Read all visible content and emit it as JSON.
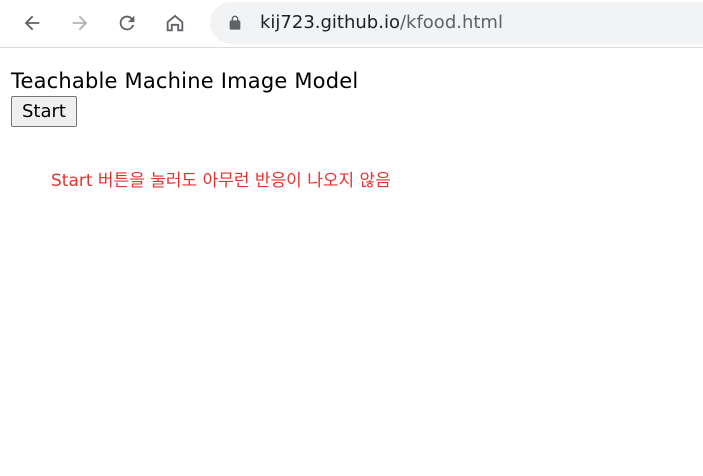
{
  "browser": {
    "url_host": "kij723.github.io",
    "url_path": "/kfood.html",
    "icons": {
      "back": "back-arrow-icon",
      "forward": "forward-arrow-icon",
      "reload": "reload-icon",
      "home": "home-icon",
      "lock": "lock-icon"
    }
  },
  "page": {
    "title": "Teachable Machine Image Model",
    "start_button": "Start",
    "annotation": "Start 버튼을 눌러도 아무런 반응이 나오지 않음"
  },
  "colors": {
    "annotation": "#e8312f",
    "omnibox_bg": "#f1f3f4"
  }
}
